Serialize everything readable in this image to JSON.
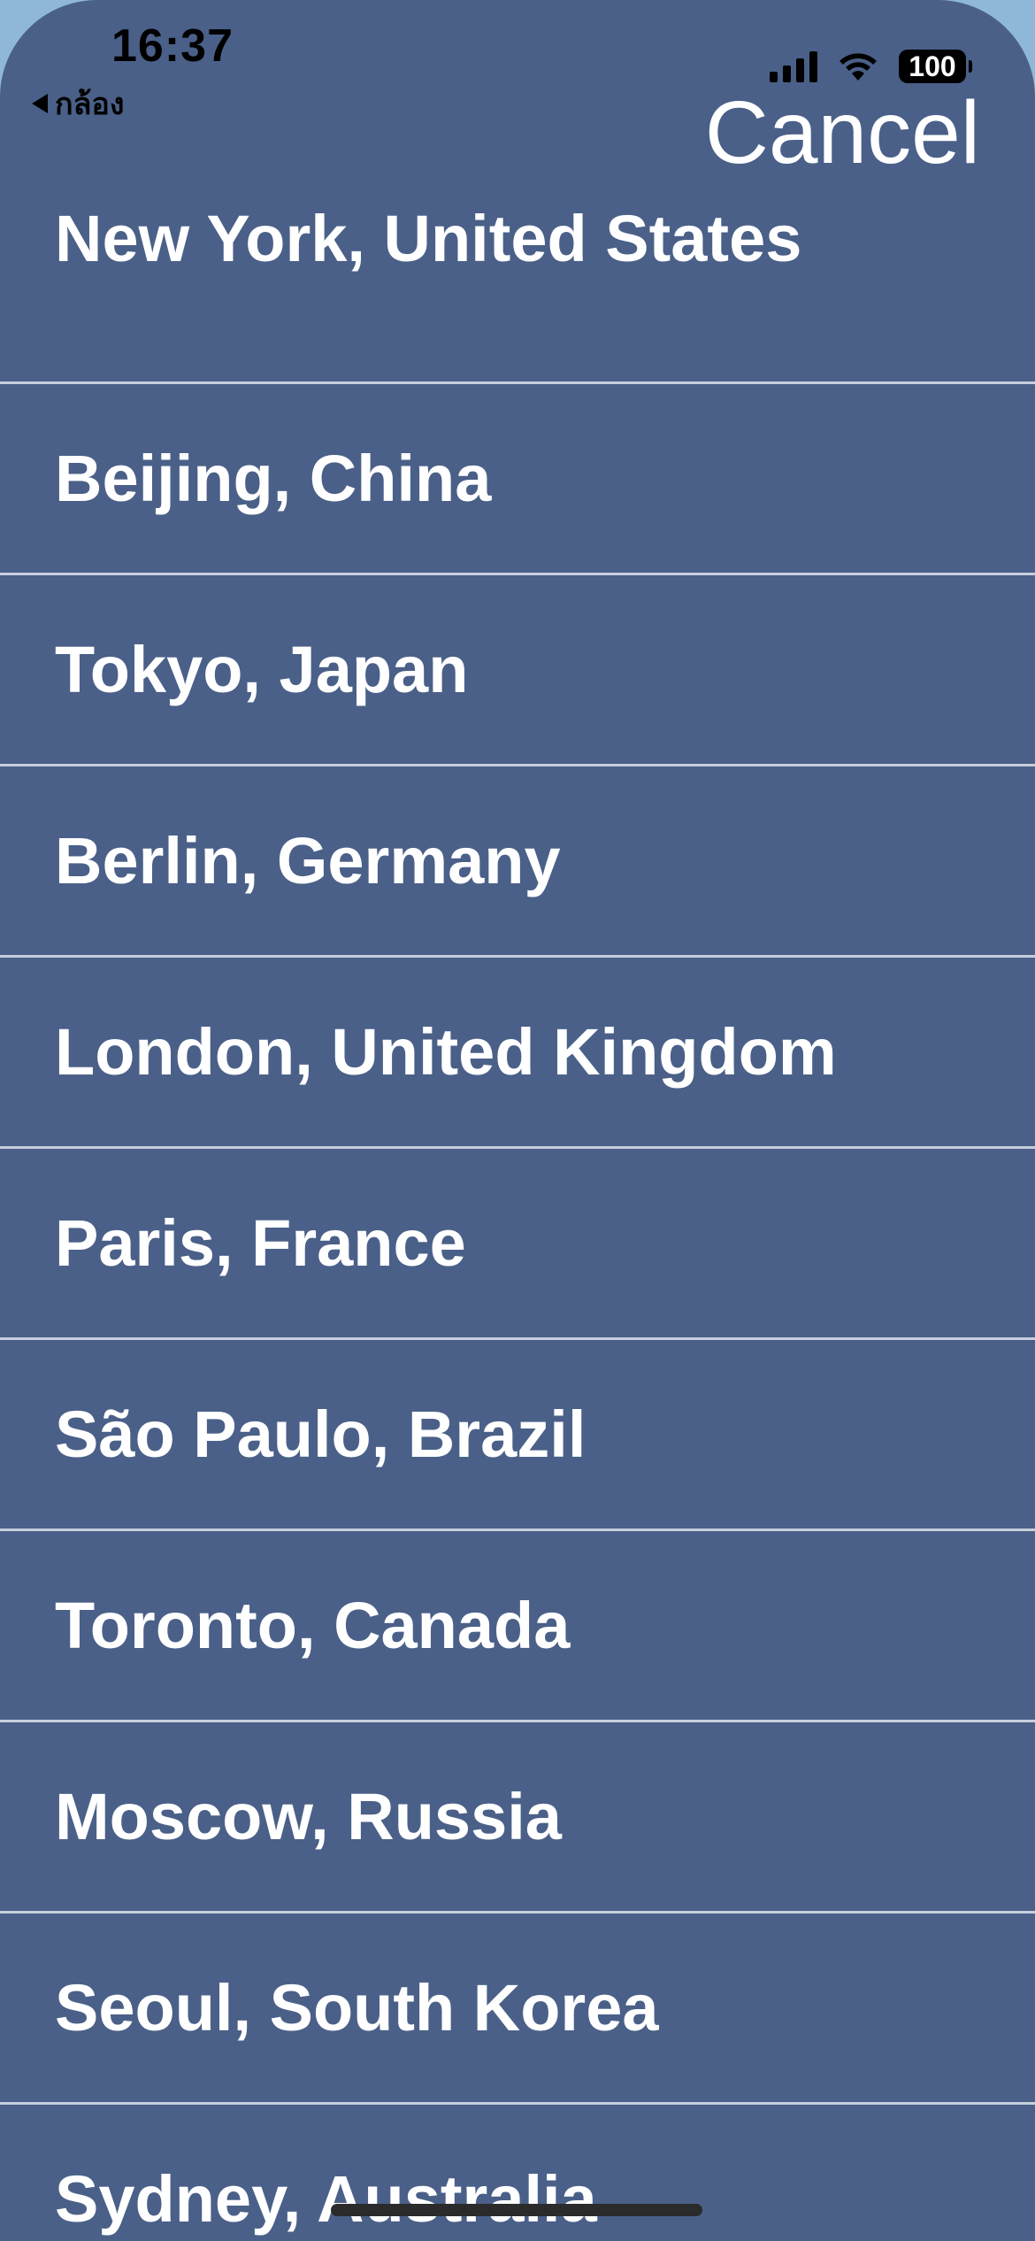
{
  "status_bar": {
    "time": "16:37",
    "back_app": "กล้อง",
    "battery": "100"
  },
  "header": {
    "cancel_label": "Cancel"
  },
  "cities": [
    {
      "label": "New York, United States"
    },
    {
      "label": "Beijing, China"
    },
    {
      "label": "Tokyo, Japan"
    },
    {
      "label": "Berlin, Germany"
    },
    {
      "label": "London, United Kingdom"
    },
    {
      "label": "Paris, France"
    },
    {
      "label": "São Paulo, Brazil"
    },
    {
      "label": "Toronto, Canada"
    },
    {
      "label": "Moscow, Russia"
    },
    {
      "label": "Seoul, South Korea"
    },
    {
      "label": "Sydney, Australia"
    }
  ],
  "colors": {
    "background": "#4a6088",
    "separator": "#c7cfdd",
    "text": "#ffffff"
  }
}
